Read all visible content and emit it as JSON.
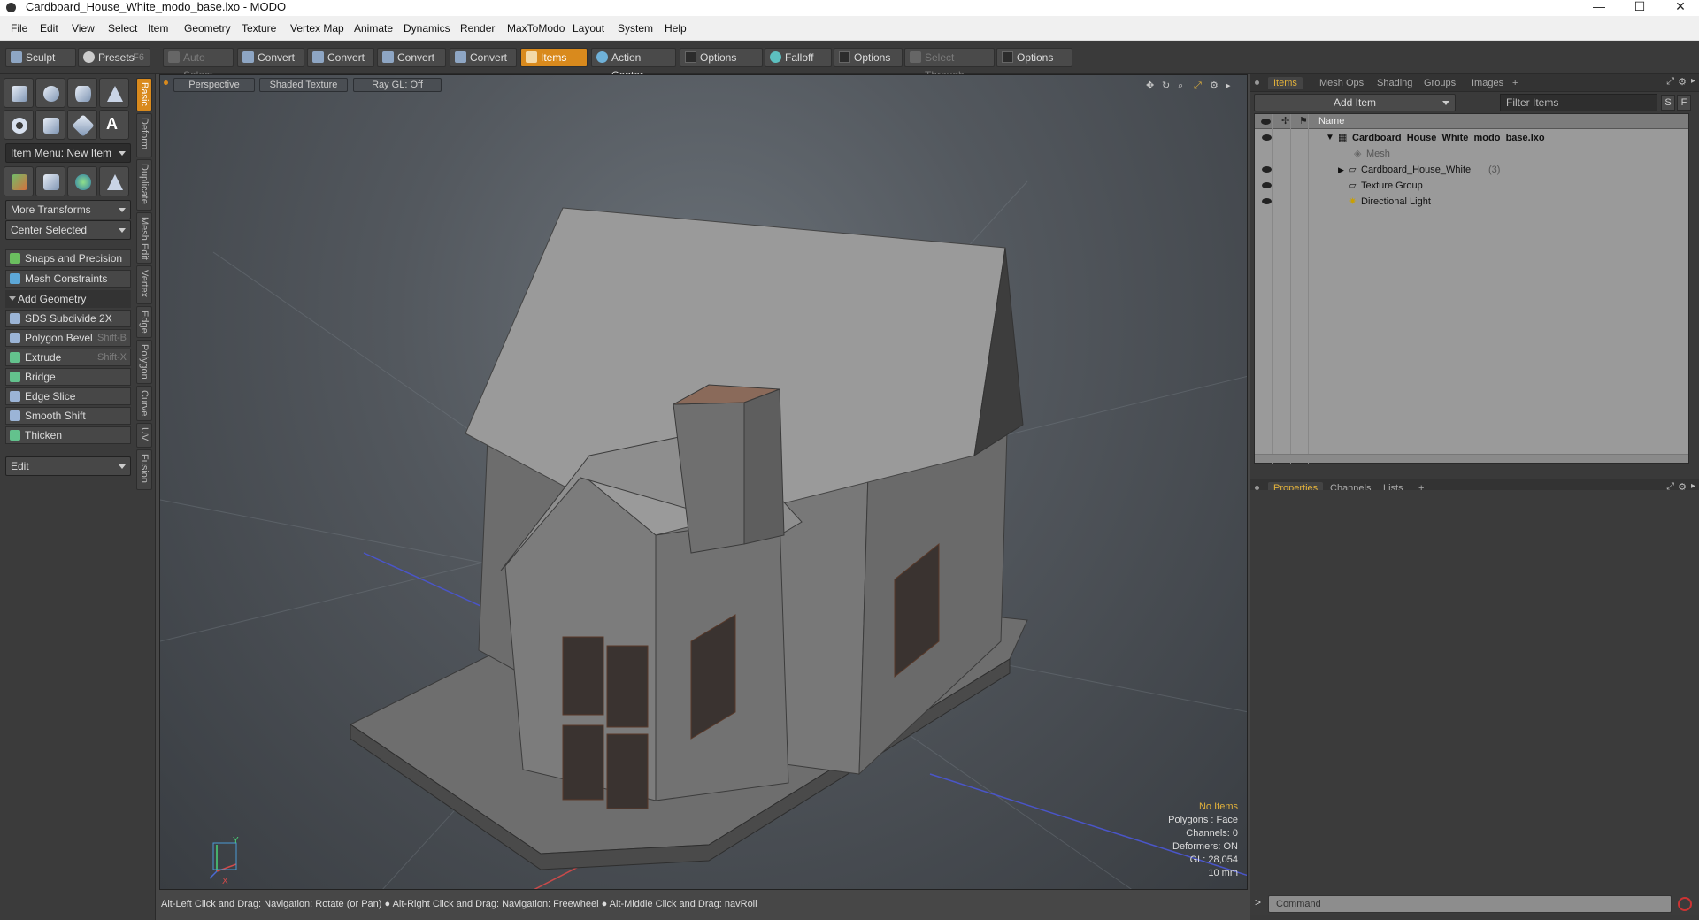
{
  "window": {
    "title": "Cardboard_House_White_modo_base.lxo - MODO",
    "minimize": "—",
    "maximize": "☐",
    "close": "✕"
  },
  "menu": [
    "File",
    "Edit",
    "View",
    "Select",
    "Item",
    "Geometry",
    "Texture",
    "Vertex Map",
    "Animate",
    "Dynamics",
    "Render",
    "MaxToModo",
    "Layout",
    "System",
    "Help"
  ],
  "toolbar": {
    "sculpt": "Sculpt",
    "presets": "Presets",
    "presets_hotkey": "F6",
    "auto_select": "Auto Select",
    "convert1": "Convert",
    "convert2": "Convert",
    "convert3": "Convert",
    "convert4": "Convert",
    "items": "Items",
    "action_center": "Action Center",
    "options1": "Options",
    "falloff": "Falloff",
    "options2": "Options",
    "select_through": "Select Through",
    "options3": "Options"
  },
  "left_panel": {
    "item_menu": "Item Menu: New Item",
    "more_transforms": "More Transforms",
    "center_selected": "Center Selected",
    "snaps": "Snaps and Precision",
    "mesh_constraints": "Mesh Constraints",
    "add_geometry": "Add Geometry",
    "tools": [
      {
        "label": "SDS Subdivide 2X",
        "hotkey": ""
      },
      {
        "label": "Polygon Bevel",
        "hotkey": "Shift-B"
      },
      {
        "label": "Extrude",
        "hotkey": "Shift-X"
      },
      {
        "label": "Bridge",
        "hotkey": ""
      },
      {
        "label": "Edge Slice",
        "hotkey": ""
      },
      {
        "label": "Smooth Shift",
        "hotkey": ""
      },
      {
        "label": "Thicken",
        "hotkey": ""
      }
    ],
    "edit_dropdown": "Edit",
    "vertical_tabs": [
      "Basic",
      "Deform",
      "Duplicate",
      "Mesh Edit",
      "Vertex",
      "Edge",
      "Polygon",
      "Curve",
      "UV",
      "Fusion"
    ]
  },
  "viewport": {
    "view": "Perspective",
    "shading": "Shaded Texture",
    "raygl": "Ray GL: Off",
    "stats": {
      "selection": "No Items",
      "polygons": "Polygons : Face",
      "channels": "Channels: 0",
      "deformers": "Deformers: ON",
      "gl": "GL: 28,054",
      "scale": "10 mm"
    },
    "axis_y": "Y",
    "axis_x": "X"
  },
  "status": "Alt-Left Click and Drag: Navigation: Rotate (or Pan) ● Alt-Right Click and Drag: Navigation: Freewheel ● Alt-Middle Click and Drag: navRoll",
  "right_panel": {
    "tabs": [
      "Items",
      "Mesh Ops",
      "Shading",
      "Groups",
      "Images",
      "+"
    ],
    "add_item": "Add Item",
    "filter_placeholder": "Filter Items",
    "btn_s": "S",
    "btn_f": "F",
    "name_header": "Name",
    "tree": [
      {
        "label": "Cardboard_House_White_modo_base.lxo",
        "count": ""
      },
      {
        "label": "Mesh",
        "count": ""
      },
      {
        "label": "Cardboard_House_White",
        "count": "(3)"
      },
      {
        "label": "Texture Group",
        "count": ""
      },
      {
        "label": "Directional Light",
        "count": ""
      }
    ],
    "prop_tabs": [
      "Properties",
      "Channels",
      "Lists",
      "+"
    ]
  },
  "command_placeholder": "Command",
  "command_prompt": ">"
}
